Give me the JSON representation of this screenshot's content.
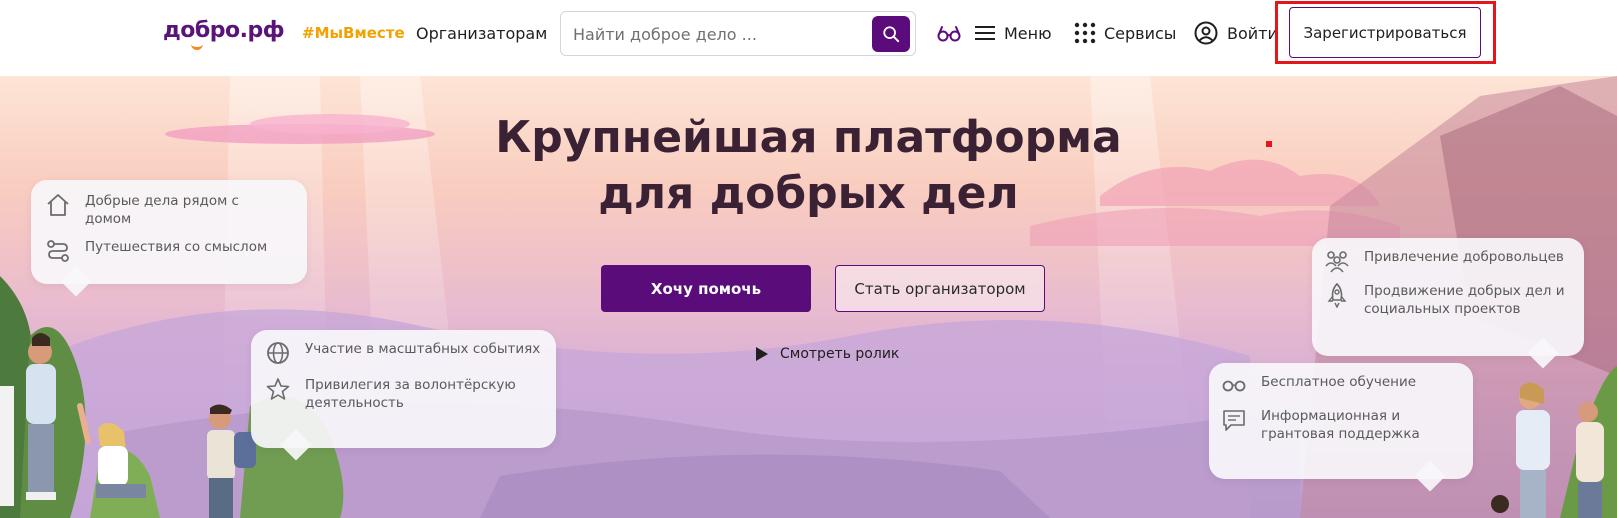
{
  "header": {
    "logo": "добро.рф",
    "tag_link": "#МыВместе",
    "organizers_link": "Организаторам",
    "search_placeholder": "Найти доброе дело ...",
    "menu_label": "Меню",
    "services_label": "Сервисы",
    "login_label": "Войти",
    "register_label": "Зарегистрироваться"
  },
  "hero": {
    "title_line1": "Крупнейшая платформа",
    "title_line2": "для добрых дел",
    "help_button": "Хочу помочь",
    "organizer_button": "Стать организатором",
    "video_link": "Смотреть ролик"
  },
  "bubbles": {
    "left_top": [
      {
        "icon": "home-icon",
        "text": "Добрые дела рядом с домом"
      },
      {
        "icon": "route-icon",
        "text": "Путешествия со смыслом"
      }
    ],
    "left_mid": [
      {
        "icon": "globe-icon",
        "text": "Участие в масштабных событиях"
      },
      {
        "icon": "star-icon",
        "text": "Привилегия за волонтёрскую деятельность"
      }
    ],
    "right_top": [
      {
        "icon": "people-icon",
        "text": "Привлечение добровольцев"
      },
      {
        "icon": "rocket-icon",
        "text": "Продвижение добрых дел и социальных проектов"
      }
    ],
    "right_mid": [
      {
        "icon": "glasses-icon",
        "text": "Бесплатное обучение"
      },
      {
        "icon": "chat-icon",
        "text": "Информационная и грантовая поддержка"
      }
    ]
  },
  "colors": {
    "brand_purple": "#5a0d7a",
    "accent_orange": "#f28a1e",
    "tag_yellow": "#f2a100",
    "highlight_red": "#e3161c"
  }
}
